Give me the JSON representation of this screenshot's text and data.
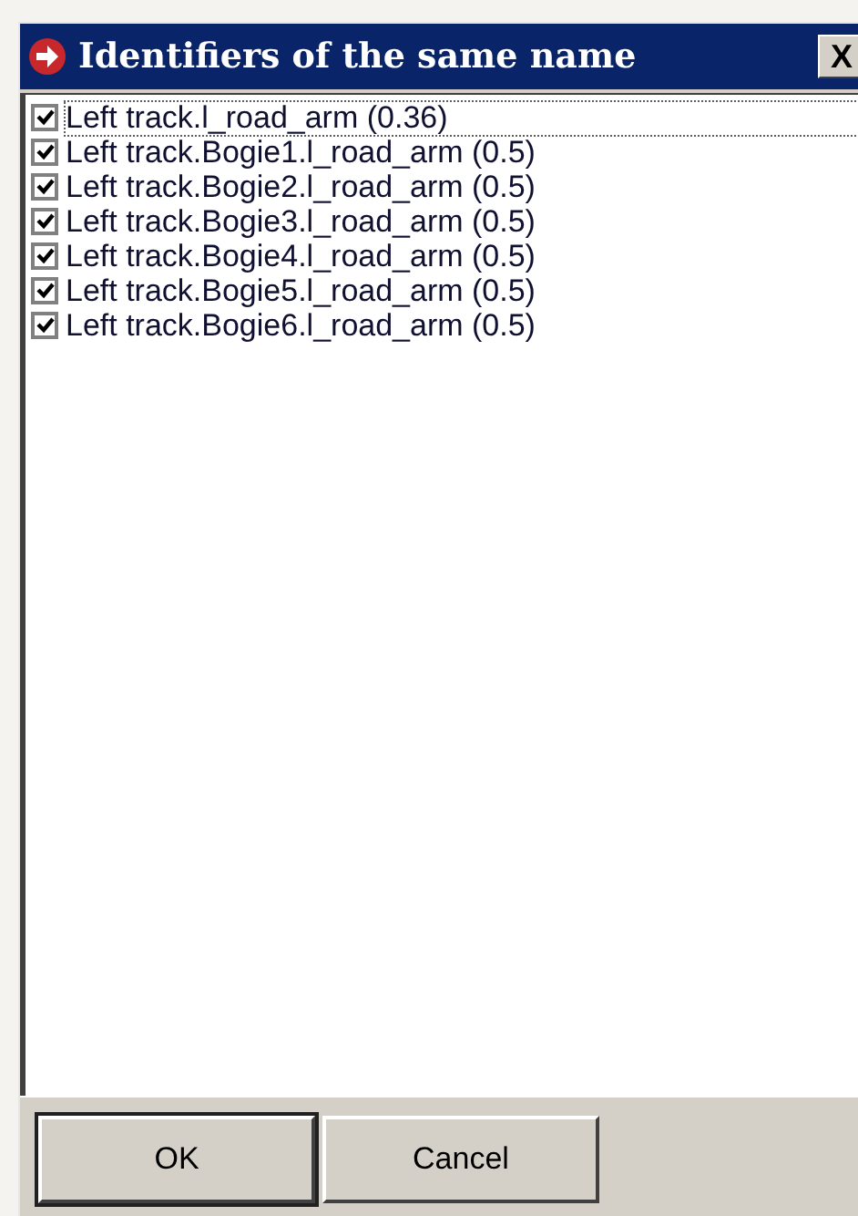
{
  "window": {
    "title": "Identifiers of the same name",
    "close": "X"
  },
  "items": [
    {
      "label": "Left track.l_road_arm (0.36)",
      "checked": true,
      "focused": true
    },
    {
      "label": "Left track.Bogie1.l_road_arm (0.5)",
      "checked": true,
      "focused": false
    },
    {
      "label": "Left track.Bogie2.l_road_arm (0.5)",
      "checked": true,
      "focused": false
    },
    {
      "label": "Left track.Bogie3.l_road_arm (0.5)",
      "checked": true,
      "focused": false
    },
    {
      "label": "Left track.Bogie4.l_road_arm (0.5)",
      "checked": true,
      "focused": false
    },
    {
      "label": "Left track.Bogie5.l_road_arm (0.5)",
      "checked": true,
      "focused": false
    },
    {
      "label": "Left track.Bogie6.l_road_arm (0.5)",
      "checked": true,
      "focused": false
    }
  ],
  "buttons": [
    {
      "label": "OK",
      "default": true
    },
    {
      "label": "Cancel",
      "default": false
    }
  ]
}
